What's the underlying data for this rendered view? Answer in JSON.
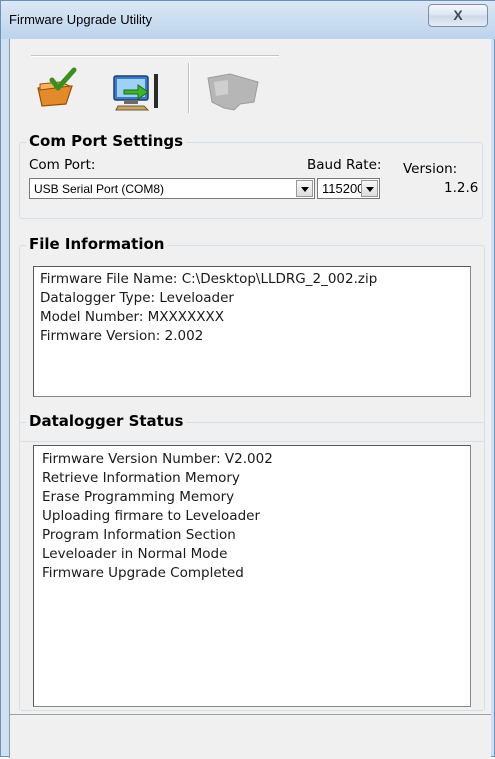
{
  "window": {
    "title": "Firmware Upgrade Utility",
    "close_glyph": "X"
  },
  "toolbar": {
    "buttons": [
      {
        "name": "open-firmware-icon",
        "color": "#d97a20"
      },
      {
        "name": "upload-to-datalogger-icon",
        "color": "#2f7bd0"
      },
      {
        "name": "datalogger-device-icon",
        "color": "#a0a0a0",
        "disabled": true
      }
    ]
  },
  "com_port_settings": {
    "title": "Com Port Settings",
    "com_port_label": "Com Port:",
    "com_port_value": "USB Serial Port (COM8)",
    "baud_rate_label": "Baud Rate:",
    "baud_rate_value": "115200",
    "version_label": "Version:",
    "version_value": "1.2.6"
  },
  "file_information": {
    "title": "File Information",
    "lines": [
      "Firmware File Name: C:\\Desktop\\LLDRG_2_002.zip",
      "Datalogger Type: Leveloader",
      "Model Number: MXXXXXXX",
      "Firmware Version: 2.002"
    ]
  },
  "datalogger_status": {
    "title": "Datalogger Status",
    "lines": [
      "Firmware Version Number: V2.002",
      "Retrieve Information Memory",
      "Erase Programming Memory",
      "Uploading firmare to Leveloader",
      "Program Information Section",
      "Leveloader in Normal Mode",
      "Firmware Upgrade Completed"
    ]
  },
  "status_bar": {
    "text": ""
  }
}
